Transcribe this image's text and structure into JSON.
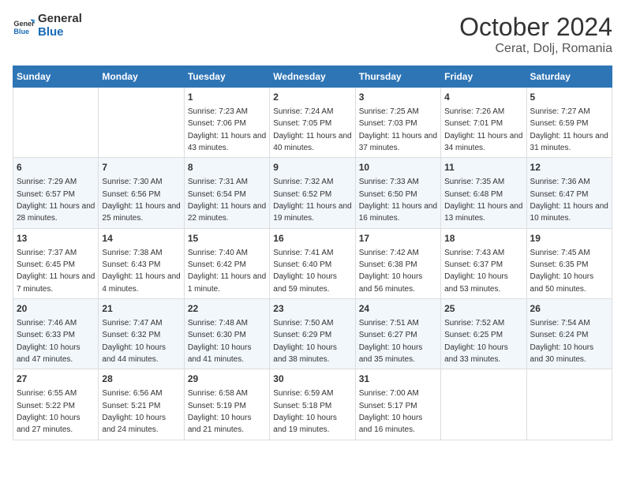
{
  "header": {
    "logo_text_general": "General",
    "logo_text_blue": "Blue",
    "title": "October 2024",
    "subtitle": "Cerat, Dolj, Romania"
  },
  "weekdays": [
    "Sunday",
    "Monday",
    "Tuesday",
    "Wednesday",
    "Thursday",
    "Friday",
    "Saturday"
  ],
  "weeks": [
    [
      {
        "day": "",
        "sunrise": "",
        "sunset": "",
        "daylight": ""
      },
      {
        "day": "",
        "sunrise": "",
        "sunset": "",
        "daylight": ""
      },
      {
        "day": "1",
        "sunrise": "Sunrise: 7:23 AM",
        "sunset": "Sunset: 7:06 PM",
        "daylight": "Daylight: 11 hours and 43 minutes."
      },
      {
        "day": "2",
        "sunrise": "Sunrise: 7:24 AM",
        "sunset": "Sunset: 7:05 PM",
        "daylight": "Daylight: 11 hours and 40 minutes."
      },
      {
        "day": "3",
        "sunrise": "Sunrise: 7:25 AM",
        "sunset": "Sunset: 7:03 PM",
        "daylight": "Daylight: 11 hours and 37 minutes."
      },
      {
        "day": "4",
        "sunrise": "Sunrise: 7:26 AM",
        "sunset": "Sunset: 7:01 PM",
        "daylight": "Daylight: 11 hours and 34 minutes."
      },
      {
        "day": "5",
        "sunrise": "Sunrise: 7:27 AM",
        "sunset": "Sunset: 6:59 PM",
        "daylight": "Daylight: 11 hours and 31 minutes."
      }
    ],
    [
      {
        "day": "6",
        "sunrise": "Sunrise: 7:29 AM",
        "sunset": "Sunset: 6:57 PM",
        "daylight": "Daylight: 11 hours and 28 minutes."
      },
      {
        "day": "7",
        "sunrise": "Sunrise: 7:30 AM",
        "sunset": "Sunset: 6:56 PM",
        "daylight": "Daylight: 11 hours and 25 minutes."
      },
      {
        "day": "8",
        "sunrise": "Sunrise: 7:31 AM",
        "sunset": "Sunset: 6:54 PM",
        "daylight": "Daylight: 11 hours and 22 minutes."
      },
      {
        "day": "9",
        "sunrise": "Sunrise: 7:32 AM",
        "sunset": "Sunset: 6:52 PM",
        "daylight": "Daylight: 11 hours and 19 minutes."
      },
      {
        "day": "10",
        "sunrise": "Sunrise: 7:33 AM",
        "sunset": "Sunset: 6:50 PM",
        "daylight": "Daylight: 11 hours and 16 minutes."
      },
      {
        "day": "11",
        "sunrise": "Sunrise: 7:35 AM",
        "sunset": "Sunset: 6:48 PM",
        "daylight": "Daylight: 11 hours and 13 minutes."
      },
      {
        "day": "12",
        "sunrise": "Sunrise: 7:36 AM",
        "sunset": "Sunset: 6:47 PM",
        "daylight": "Daylight: 11 hours and 10 minutes."
      }
    ],
    [
      {
        "day": "13",
        "sunrise": "Sunrise: 7:37 AM",
        "sunset": "Sunset: 6:45 PM",
        "daylight": "Daylight: 11 hours and 7 minutes."
      },
      {
        "day": "14",
        "sunrise": "Sunrise: 7:38 AM",
        "sunset": "Sunset: 6:43 PM",
        "daylight": "Daylight: 11 hours and 4 minutes."
      },
      {
        "day": "15",
        "sunrise": "Sunrise: 7:40 AM",
        "sunset": "Sunset: 6:42 PM",
        "daylight": "Daylight: 11 hours and 1 minute."
      },
      {
        "day": "16",
        "sunrise": "Sunrise: 7:41 AM",
        "sunset": "Sunset: 6:40 PM",
        "daylight": "Daylight: 10 hours and 59 minutes."
      },
      {
        "day": "17",
        "sunrise": "Sunrise: 7:42 AM",
        "sunset": "Sunset: 6:38 PM",
        "daylight": "Daylight: 10 hours and 56 minutes."
      },
      {
        "day": "18",
        "sunrise": "Sunrise: 7:43 AM",
        "sunset": "Sunset: 6:37 PM",
        "daylight": "Daylight: 10 hours and 53 minutes."
      },
      {
        "day": "19",
        "sunrise": "Sunrise: 7:45 AM",
        "sunset": "Sunset: 6:35 PM",
        "daylight": "Daylight: 10 hours and 50 minutes."
      }
    ],
    [
      {
        "day": "20",
        "sunrise": "Sunrise: 7:46 AM",
        "sunset": "Sunset: 6:33 PM",
        "daylight": "Daylight: 10 hours and 47 minutes."
      },
      {
        "day": "21",
        "sunrise": "Sunrise: 7:47 AM",
        "sunset": "Sunset: 6:32 PM",
        "daylight": "Daylight: 10 hours and 44 minutes."
      },
      {
        "day": "22",
        "sunrise": "Sunrise: 7:48 AM",
        "sunset": "Sunset: 6:30 PM",
        "daylight": "Daylight: 10 hours and 41 minutes."
      },
      {
        "day": "23",
        "sunrise": "Sunrise: 7:50 AM",
        "sunset": "Sunset: 6:29 PM",
        "daylight": "Daylight: 10 hours and 38 minutes."
      },
      {
        "day": "24",
        "sunrise": "Sunrise: 7:51 AM",
        "sunset": "Sunset: 6:27 PM",
        "daylight": "Daylight: 10 hours and 35 minutes."
      },
      {
        "day": "25",
        "sunrise": "Sunrise: 7:52 AM",
        "sunset": "Sunset: 6:25 PM",
        "daylight": "Daylight: 10 hours and 33 minutes."
      },
      {
        "day": "26",
        "sunrise": "Sunrise: 7:54 AM",
        "sunset": "Sunset: 6:24 PM",
        "daylight": "Daylight: 10 hours and 30 minutes."
      }
    ],
    [
      {
        "day": "27",
        "sunrise": "Sunrise: 6:55 AM",
        "sunset": "Sunset: 5:22 PM",
        "daylight": "Daylight: 10 hours and 27 minutes."
      },
      {
        "day": "28",
        "sunrise": "Sunrise: 6:56 AM",
        "sunset": "Sunset: 5:21 PM",
        "daylight": "Daylight: 10 hours and 24 minutes."
      },
      {
        "day": "29",
        "sunrise": "Sunrise: 6:58 AM",
        "sunset": "Sunset: 5:19 PM",
        "daylight": "Daylight: 10 hours and 21 minutes."
      },
      {
        "day": "30",
        "sunrise": "Sunrise: 6:59 AM",
        "sunset": "Sunset: 5:18 PM",
        "daylight": "Daylight: 10 hours and 19 minutes."
      },
      {
        "day": "31",
        "sunrise": "Sunrise: 7:00 AM",
        "sunset": "Sunset: 5:17 PM",
        "daylight": "Daylight: 10 hours and 16 minutes."
      },
      {
        "day": "",
        "sunrise": "",
        "sunset": "",
        "daylight": ""
      },
      {
        "day": "",
        "sunrise": "",
        "sunset": "",
        "daylight": ""
      }
    ]
  ]
}
